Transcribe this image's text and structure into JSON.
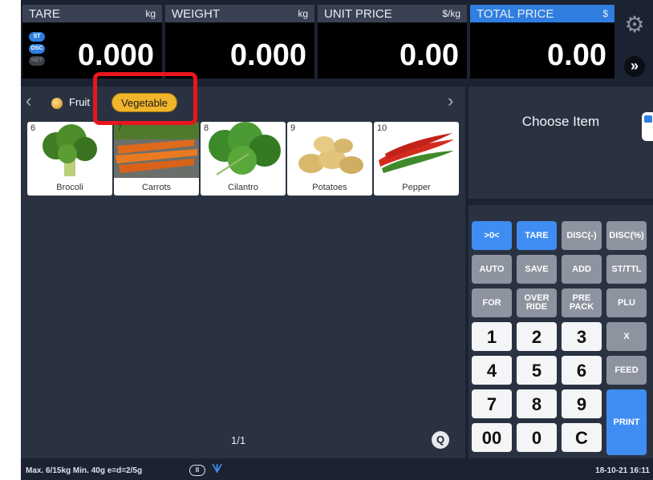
{
  "display": {
    "tare": {
      "label": "TARE",
      "unit": "kg",
      "value": "0.000"
    },
    "weight": {
      "label": "WEIGHT",
      "unit": "kg",
      "value": "0.000"
    },
    "unit_price": {
      "label": "UNIT PRICE",
      "unit": "$/kg",
      "value": "0.00"
    },
    "total_price": {
      "label": "TOTAL PRICE",
      "unit": "$",
      "value": "0.00"
    },
    "badges": [
      "ST",
      "DSC",
      "NET"
    ],
    "next_symbol": "»"
  },
  "categories": {
    "items": [
      {
        "label": "Fruit",
        "selected": false
      },
      {
        "label": "Vegetable",
        "selected": true
      }
    ],
    "prev_symbol": "‹",
    "next_symbol": "›",
    "highlight_color": "#e8161e"
  },
  "products": [
    {
      "number": "6",
      "name": "Brocoli",
      "icon": "broccoli-icon"
    },
    {
      "number": "7",
      "name": "Carrots",
      "icon": "carrot-icon"
    },
    {
      "number": "8",
      "name": "Cilantro",
      "icon": "cilantro-icon"
    },
    {
      "number": "9",
      "name": "Potatoes",
      "icon": "potato-icon"
    },
    {
      "number": "10",
      "name": "Pepper",
      "icon": "pepper-icon"
    }
  ],
  "pagination": {
    "label": "1/1"
  },
  "search_symbol": "Q",
  "choose_item": {
    "label": "Choose Item"
  },
  "keypad": {
    "function_rows": [
      [
        "&gt;0&lt;",
        "TARE",
        "DISC(-)",
        "DISC(%)"
      ],
      [
        "AUTO",
        "SAVE",
        "ADD",
        "ST/TTL"
      ],
      [
        "FOR",
        "OVER\nRIDE",
        "PRE\nPACK",
        "PLU"
      ]
    ],
    "numeric_rows": [
      [
        "1",
        "2",
        "3",
        "X"
      ],
      [
        "4",
        "5",
        "6",
        "FEED"
      ],
      [
        "7",
        "8",
        "9",
        "PRINT"
      ],
      [
        "00",
        "0",
        "C"
      ]
    ]
  },
  "footer": {
    "spec": "Max. 6/15kg  Min. 40g  e=d=2/5g",
    "badge": "II",
    "datetime": "18-10-21 16:11"
  },
  "colors": {
    "background": "#1b2231",
    "panel": "#2a3242",
    "accent": "#2f7ee0",
    "selected_chip": "#f1b52b"
  }
}
